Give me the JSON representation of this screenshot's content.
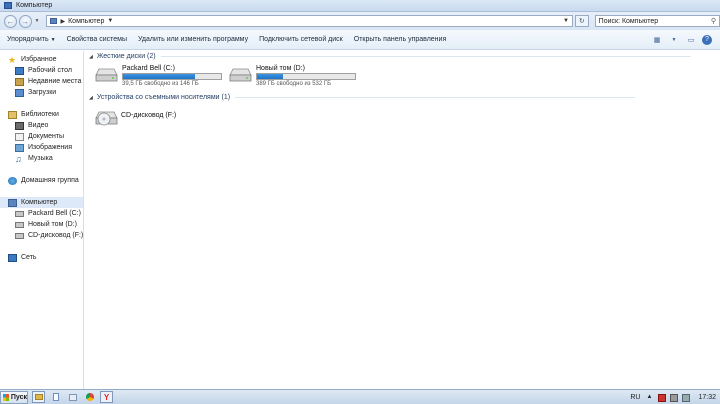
{
  "window": {
    "title": "Компьютер"
  },
  "nav": {
    "crumb": "Компьютер",
    "search_placeholder": "Поиск: Компьютер"
  },
  "toolbar": {
    "organize": "Упорядочить",
    "properties": "Свойства системы",
    "uninstall": "Удалить или изменить программу",
    "map_drive": "Подключить сетевой диск",
    "control_panel": "Открыть панель управления"
  },
  "sidebar": {
    "favorites": "Избранное",
    "desktop": "Рабочий стол",
    "recent": "Недавние места",
    "downloads": "Загрузки",
    "libraries": "Библиотеки",
    "video": "Видео",
    "documents": "Документы",
    "pictures": "Изображения",
    "music": "Музыка",
    "homegroup": "Домашняя группа",
    "computer": "Компьютер",
    "drive_c": "Packard Bell (C:)",
    "drive_d": "Новый том (D:)",
    "drive_f": "CD-дисковод (F:)",
    "network": "Сеть"
  },
  "main": {
    "hdd_group": "Жесткие диски (2)",
    "removable_group": "Устройства со съемными носителями (1)",
    "drives": [
      {
        "name": "Packard Bell (C:)",
        "free": "39,5 ГБ свободно из 146 ГБ",
        "used_fraction": 0.73
      },
      {
        "name": "Новый том (D:)",
        "free": "389 ГБ свободно из 532 ГБ",
        "used_fraction": 0.27
      }
    ],
    "cd": {
      "name": "CD-дисковод (F:)"
    }
  },
  "taskbar": {
    "start": "Пуск",
    "lang": "RU",
    "time": "17:32"
  },
  "colors": {
    "accent": "#1e73c8",
    "selection": "#dde9f8"
  }
}
